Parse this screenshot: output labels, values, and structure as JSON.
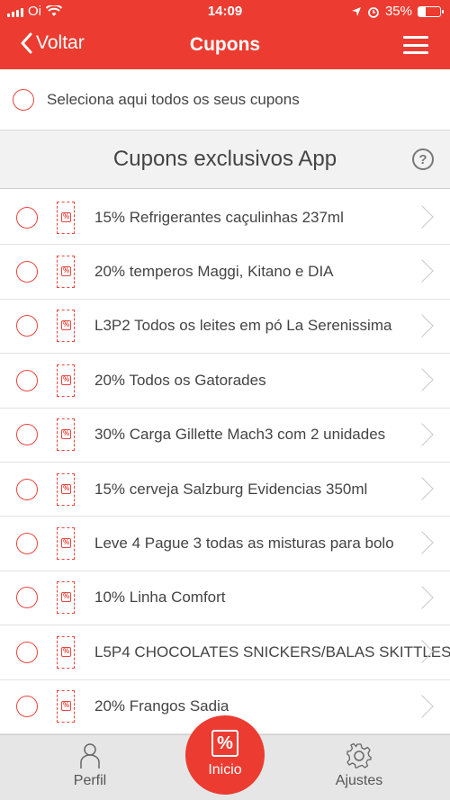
{
  "status_bar": {
    "carrier": "Oi",
    "time": "14:09",
    "battery": "35%",
    "battery_level": 0.35
  },
  "header": {
    "back_label": "Voltar",
    "title": "Cupons"
  },
  "select_all": {
    "label": "Seleciona aqui todos os seus cupons"
  },
  "section": {
    "title": "Cupons exclusivos App",
    "help_icon": "?"
  },
  "coupons": [
    {
      "label": "15% Refrigerantes caçulinhas 237ml"
    },
    {
      "label": "20% temperos Maggi, Kitano e DIA"
    },
    {
      "label": "L3P2 Todos os leites em pó La Serenissima"
    },
    {
      "label": "20% Todos os Gatorades"
    },
    {
      "label": "30% Carga Gillette Mach3 com 2 unidades"
    },
    {
      "label": "15% cerveja Salzburg Evidencias 350ml"
    },
    {
      "label": "Leve 4 Pague 3 todas as misturas para bolo"
    },
    {
      "label": "10% Linha Comfort"
    },
    {
      "label": "L5P4 CHOCOLATES SNICKERS/BALAS SKITTLES"
    },
    {
      "label": "20% Frangos Sadia"
    }
  ],
  "tab_bar": {
    "profile": "Perfil",
    "home": "Inicio",
    "settings": "Ajustes"
  },
  "colors": {
    "brand": "#ec3b30",
    "tab_bg": "#e6e6e6"
  }
}
